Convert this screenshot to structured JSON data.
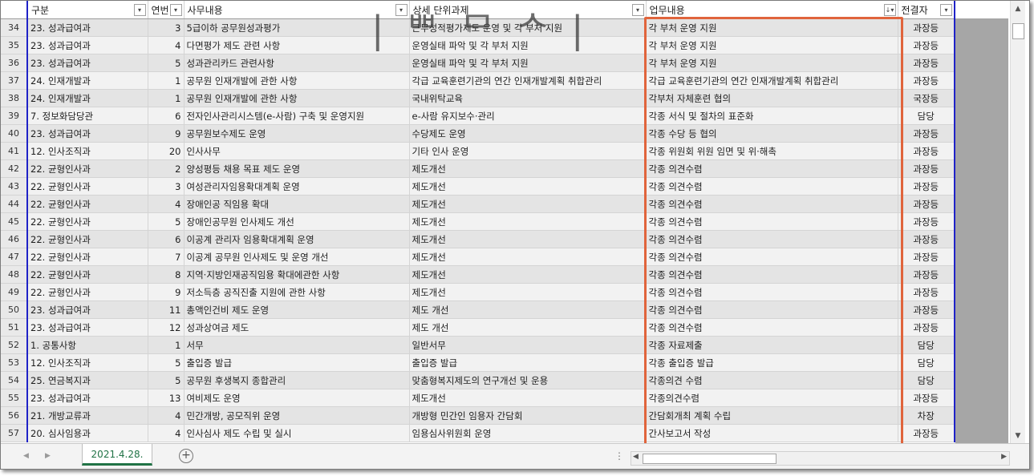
{
  "columns": [
    {
      "label": "구분",
      "filter": "▾"
    },
    {
      "label": "연번",
      "filter": "▾"
    },
    {
      "label": "사무내용",
      "filter": "▾"
    },
    {
      "label": "상세 단위과제",
      "filter": "▾"
    },
    {
      "label": "업무내용",
      "filter": "↓▾"
    },
    {
      "label": "전결자",
      "filter": "▾"
    }
  ],
  "rows": [
    {
      "n": "34",
      "a": "23. 성과급여과",
      "b": "3",
      "c": "5급이하 공무원성과평가",
      "d": "근무성적평가제도 운영 및 각 부처 지원",
      "e": "각 부처 운영 지원",
      "f": "과장등"
    },
    {
      "n": "35",
      "a": "23. 성과급여과",
      "b": "4",
      "c": "다면평가 제도 관련 사항",
      "d": "운영실태 파악 및 각 부처 지원",
      "e": "각 부처 운영 지원",
      "f": "과장등"
    },
    {
      "n": "36",
      "a": "23. 성과급여과",
      "b": "5",
      "c": "성과관리카드 관련사항",
      "d": "운영실태 파악 및 각 부처 지원",
      "e": "각 부처 운영 지원",
      "f": "과장등"
    },
    {
      "n": "37",
      "a": "24. 인재개발과",
      "b": "1",
      "c": "공무원 인재개발에 관한 사항",
      "d": "각급 교육훈련기관의 연간 인재개발계획 취합관리",
      "e": "각급 교육훈련기관의 연간 인재개발계획 취합관리",
      "f": "과장등"
    },
    {
      "n": "38",
      "a": "24. 인재개발과",
      "b": "1",
      "c": "공무원 인재개발에 관한 사항",
      "d": "국내위탁교육",
      "e": "각부처 자체훈련 협의",
      "f": "국장등"
    },
    {
      "n": "39",
      "a": "7. 정보화담당관",
      "b": "6",
      "c": "전자인사관리시스템(e-사람) 구축 및 운영지원",
      "d": "e-사람 유지보수·관리",
      "e": "각종 서식 및 절차의 표준화",
      "f": "담당"
    },
    {
      "n": "40",
      "a": "23. 성과급여과",
      "b": "9",
      "c": "공무원보수제도 운영",
      "d": "수당제도 운영",
      "e": "각종 수당 등 협의",
      "f": "과장등"
    },
    {
      "n": "41",
      "a": "12. 인사조직과",
      "b": "20",
      "c": "인사사무",
      "d": "기타 인사 운영",
      "e": "각종 위원회 위원 임면 및 위·해촉",
      "f": "과장등"
    },
    {
      "n": "42",
      "a": "22. 균형인사과",
      "b": "2",
      "c": "양성평등 채용 목표 제도 운영",
      "d": "제도개선",
      "e": "각종 의견수렴",
      "f": "과장등"
    },
    {
      "n": "43",
      "a": "22. 균형인사과",
      "b": "3",
      "c": "여성관리자임용확대계획 운영",
      "d": "제도개선",
      "e": "각종 의견수렴",
      "f": "과장등"
    },
    {
      "n": "44",
      "a": "22. 균형인사과",
      "b": "4",
      "c": "장애인공 직임용 확대",
      "d": "제도개선",
      "e": "각종 의견수렴",
      "f": "과장등"
    },
    {
      "n": "45",
      "a": "22. 균형인사과",
      "b": "5",
      "c": "장애인공무원 인사제도 개선",
      "d": "제도개선",
      "e": "각종 의견수렴",
      "f": "과장등"
    },
    {
      "n": "46",
      "a": "22. 균형인사과",
      "b": "6",
      "c": "이공계 관리자 임용확대계획 운영",
      "d": "제도개선",
      "e": "각종 의견수렴",
      "f": "과장등"
    },
    {
      "n": "47",
      "a": "22. 균형인사과",
      "b": "7",
      "c": "이공계 공무원 인사제도 및 운영 개선",
      "d": "제도개선",
      "e": "각종 의견수렴",
      "f": "과장등"
    },
    {
      "n": "48",
      "a": "22. 균형인사과",
      "b": "8",
      "c": "지역·지방인재공직임용 확대에관한 사항",
      "d": "제도개선",
      "e": "각종 의견수렴",
      "f": "과장등"
    },
    {
      "n": "49",
      "a": "22. 균형인사과",
      "b": "9",
      "c": "저소득층 공직진출 지원에 관한 사항",
      "d": "제도개선",
      "e": "각종 의견수렴",
      "f": "과장등"
    },
    {
      "n": "50",
      "a": "23. 성과급여과",
      "b": "11",
      "c": "총액인건비 제도 운영",
      "d": "제도 개선",
      "e": "각종 의견수렴",
      "f": "과장등"
    },
    {
      "n": "51",
      "a": "23. 성과급여과",
      "b": "12",
      "c": "성과상여금 제도",
      "d": "제도 개선",
      "e": "각종 의견수렴",
      "f": "과장등"
    },
    {
      "n": "52",
      "a": "1. 공통사항",
      "b": "1",
      "c": "서무",
      "d": "일반서무",
      "e": "각종 자료제출",
      "f": "담당"
    },
    {
      "n": "53",
      "a": "12. 인사조직과",
      "b": "5",
      "c": "출입증 발급",
      "d": "출입증 발급",
      "e": "각종 출입증 발급",
      "f": "담당"
    },
    {
      "n": "54",
      "a": "25. 연금복지과",
      "b": "5",
      "c": "공무원 후생복지 종합관리",
      "d": "맞춤형복지제도의 연구개선 및 운용",
      "e": "각종의견 수렴",
      "f": "담당"
    },
    {
      "n": "55",
      "a": "23. 성과급여과",
      "b": "13",
      "c": "여비제도 운영",
      "d": "제도개선",
      "e": "각종의견수렴",
      "f": "과장등"
    },
    {
      "n": "56",
      "a": "21. 개방교류과",
      "b": "4",
      "c": "민간개방, 공모직위 운영",
      "d": "개방형 민간인 임용자 간담회",
      "e": "간담회개최 계획 수립",
      "f": "차장"
    },
    {
      "n": "57",
      "a": "20. 심사임용과",
      "b": "4",
      "c": "인사심사 제도 수립 및 실시",
      "d": "임용심사위원회 운영",
      "e": "간사보고서 작성",
      "f": "과장등"
    }
  ],
  "watermark": "|  ᄈ ᄆ ᄉ  |",
  "sheet_tab": "2021.4.28.",
  "add_sheet": "+",
  "icons": {
    "nav_prev": "◀",
    "nav_next": "▶",
    "scroll_up": "▲",
    "scroll_down": "▼",
    "scroll_left": "◀",
    "scroll_right": "▶",
    "dots": "⋮"
  }
}
